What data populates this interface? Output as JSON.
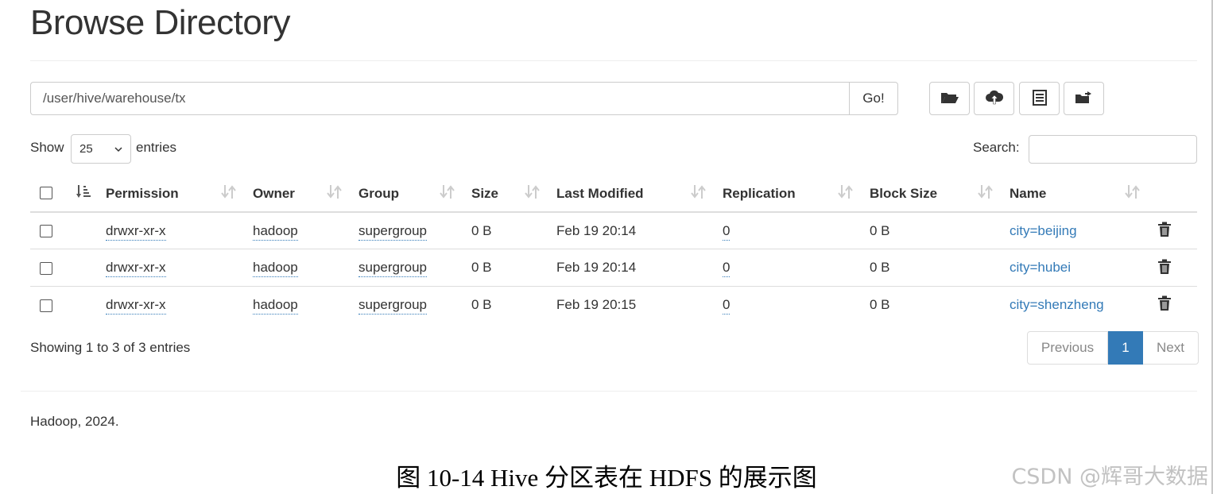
{
  "page": {
    "title": "Browse Directory"
  },
  "path_bar": {
    "value": "/user/hive/warehouse/tx",
    "go_label": "Go!"
  },
  "toolbar": {
    "buttons": [
      {
        "name": "folder-open-icon"
      },
      {
        "name": "cloud-upload-icon"
      },
      {
        "name": "list-icon"
      },
      {
        "name": "folder-move-icon"
      }
    ]
  },
  "table_controls": {
    "show_label": "Show",
    "page_length": "25",
    "entries_label": "entries",
    "search_label": "Search:",
    "search_value": ""
  },
  "table": {
    "columns": [
      "Permission",
      "Owner",
      "Group",
      "Size",
      "Last Modified",
      "Replication",
      "Block Size",
      "Name"
    ],
    "rows": [
      {
        "permission": "drwxr-xr-x",
        "owner": "hadoop",
        "group": "supergroup",
        "size": "0 B",
        "last_modified": "Feb 19 20:14",
        "replication": "0",
        "block_size": "0 B",
        "name": "city=beijing"
      },
      {
        "permission": "drwxr-xr-x",
        "owner": "hadoop",
        "group": "supergroup",
        "size": "0 B",
        "last_modified": "Feb 19 20:14",
        "replication": "0",
        "block_size": "0 B",
        "name": "city=hubei"
      },
      {
        "permission": "drwxr-xr-x",
        "owner": "hadoop",
        "group": "supergroup",
        "size": "0 B",
        "last_modified": "Feb 19 20:15",
        "replication": "0",
        "block_size": "0 B",
        "name": "city=shenzheng"
      }
    ]
  },
  "pagination": {
    "info": "Showing 1 to 3 of 3 entries",
    "previous": "Previous",
    "current": "1",
    "next": "Next"
  },
  "footer": {
    "text": "Hadoop, 2024."
  },
  "caption": {
    "text": "图 10-14 Hive 分区表在 HDFS 的展示图"
  },
  "watermark": {
    "text": "CSDN @辉哥大数据"
  },
  "colors": {
    "link": "#337ab7",
    "active_page": "#337ab7",
    "border": "#cccccc"
  }
}
